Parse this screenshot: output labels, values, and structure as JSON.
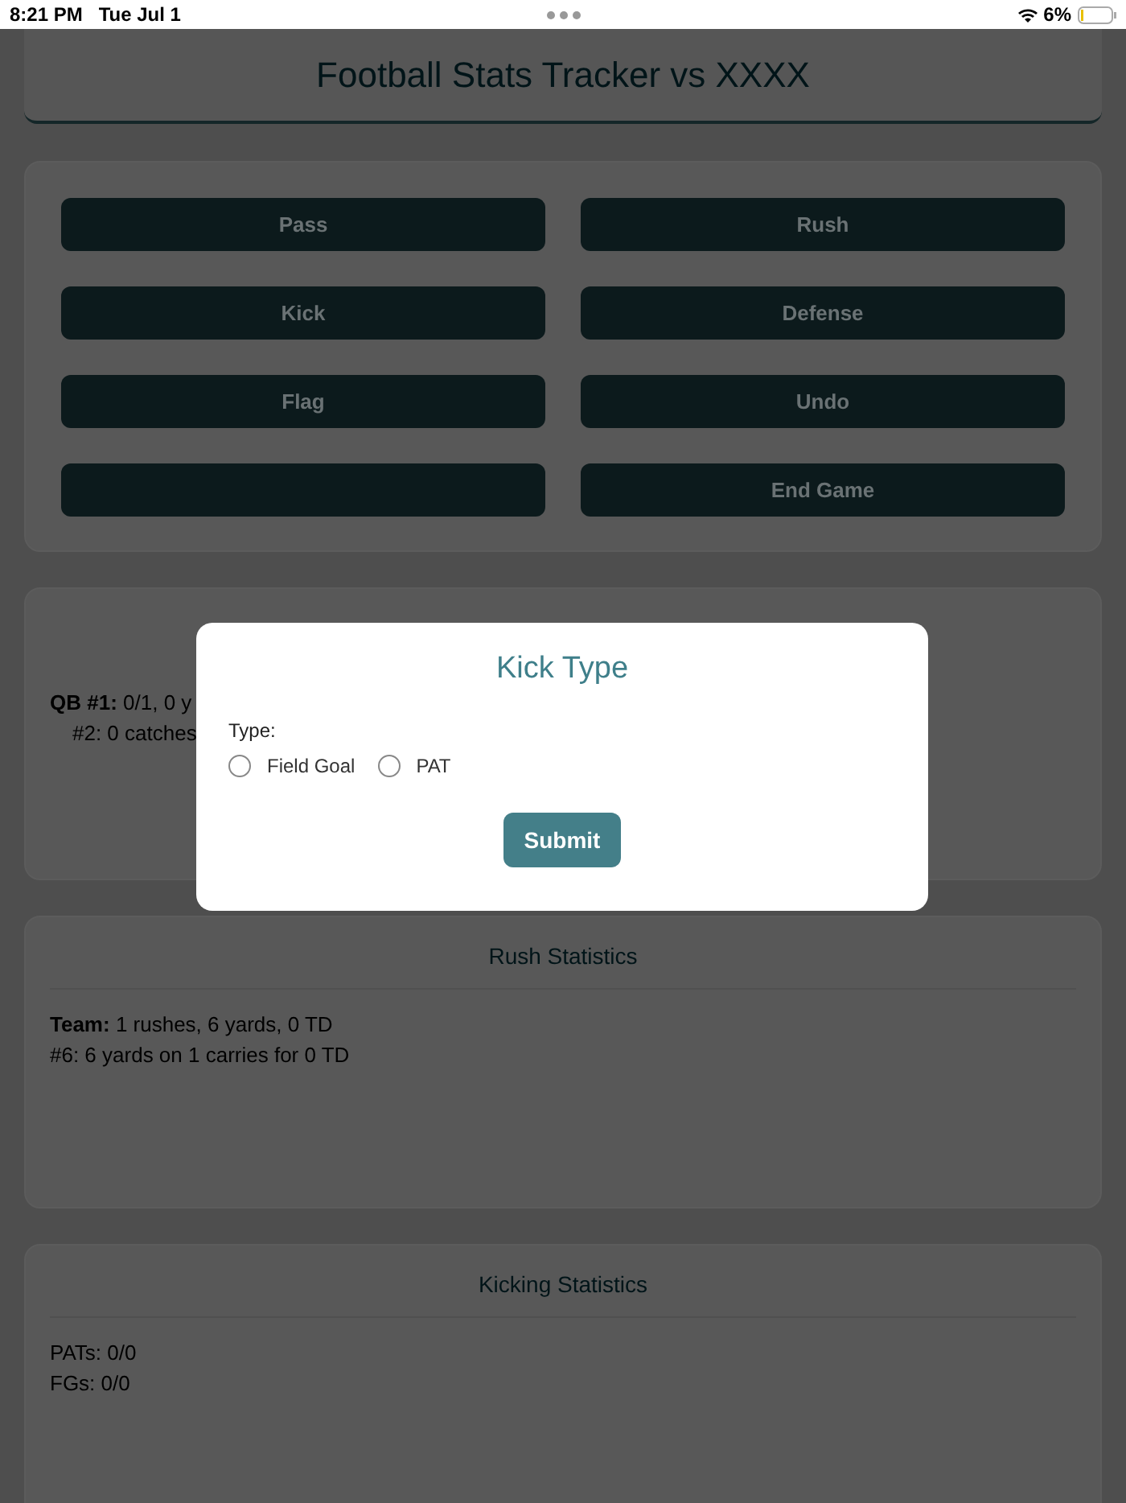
{
  "status_bar": {
    "time": "8:21 PM",
    "date": "Tue Jul 1",
    "battery": "6%"
  },
  "header": {
    "title": "Football Stats Tracker vs XXXX"
  },
  "actions": [
    {
      "label": "Pass"
    },
    {
      "label": "Rush"
    },
    {
      "label": "Kick"
    },
    {
      "label": "Defense"
    },
    {
      "label": "Flag"
    },
    {
      "label": "Undo"
    },
    {
      "kind": "blank"
    },
    {
      "label": "End Game"
    }
  ],
  "pass_stats": {
    "lines": [
      {
        "text": "**QB #1:** 0/1, 0 y",
        "children": [
          {
            "text": "#2: 0 catches"
          }
        ]
      }
    ]
  },
  "rush_stats": {
    "title": "Rush Statistics",
    "lines": [
      {
        "text": "**Team:** 1 rushes, 6 yards, 0 TD"
      },
      {
        "text": "#6: 6 yards on 1 carries for 0 TD"
      }
    ]
  },
  "kicking_stats": {
    "title": "Kicking Statistics",
    "lines": [
      {
        "text": "PATs: 0/0"
      },
      {
        "text": "FGs: 0/0"
      }
    ]
  },
  "modal": {
    "title": "Kick Type",
    "field_label": "Type:",
    "options": [
      {
        "label": "Field Goal",
        "selected": false
      },
      {
        "label": "PAT",
        "selected": false
      }
    ],
    "submit": "Submit"
  }
}
